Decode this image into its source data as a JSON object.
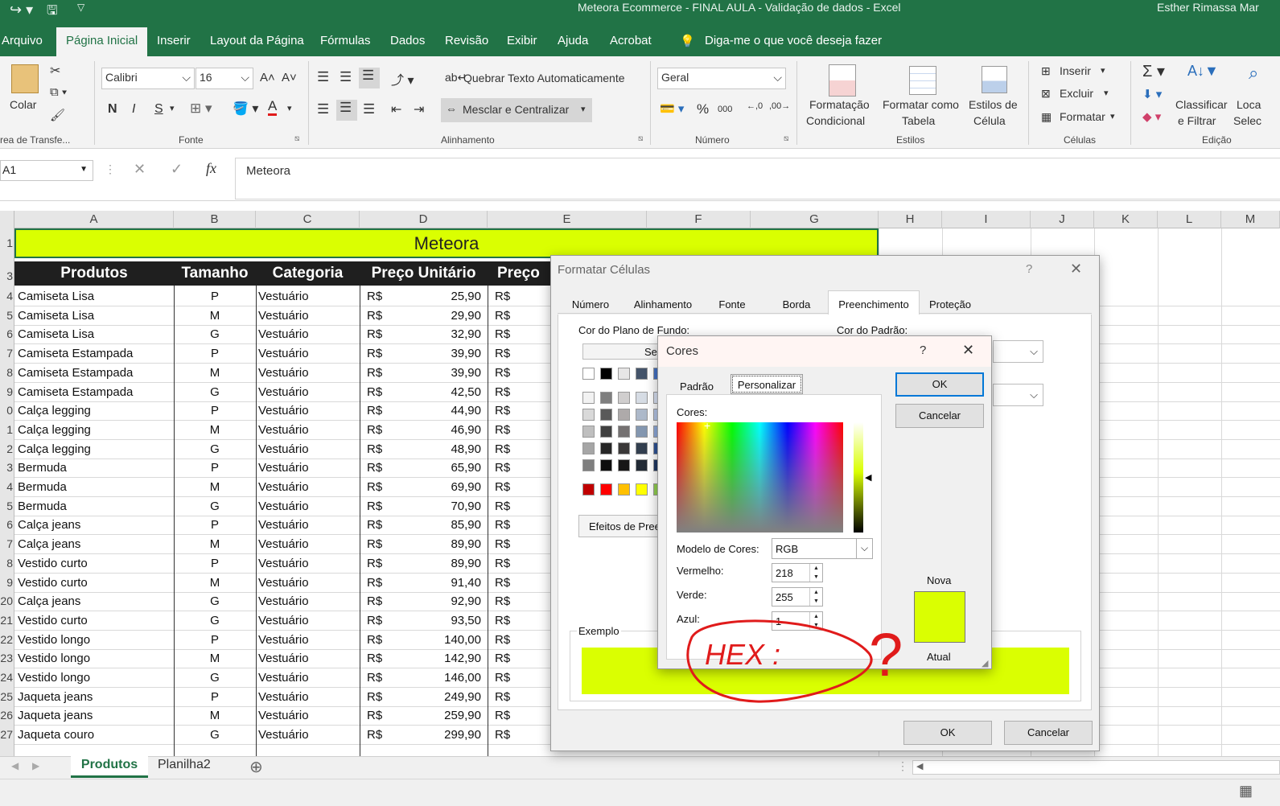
{
  "titlebar": {
    "title": "Meteora Ecommerce - FINAL AULA - Validação de dados  -  Excel",
    "user": "Esther Rimassa Mar"
  },
  "tabs": [
    "Arquivo",
    "Página Inicial",
    "Inserir",
    "Layout da Página",
    "Fórmulas",
    "Dados",
    "Revisão",
    "Exibir",
    "Ajuda",
    "Acrobat"
  ],
  "tell_me": "Diga-me o que você deseja fazer",
  "ribbon": {
    "paste": "Colar",
    "clipboard_group": "rea de Transfe...",
    "font_name": "Calibri",
    "font_size": "16",
    "font_group": "Fonte",
    "bold": "N",
    "italic": "I",
    "underline": "S",
    "wrap_text": "Quebrar Texto Automaticamente",
    "merge_center": "Mesclar e Centralizar",
    "alignment_group": "Alinhamento",
    "number_format": "Geral",
    "number_group": "Número",
    "percent": "%",
    "thousands": "000",
    "cond_format_1": "Formatação",
    "cond_format_2": "Condicional",
    "format_table_1": "Formatar como",
    "format_table_2": "Tabela",
    "cell_styles_1": "Estilos de",
    "cell_styles_2": "Célula",
    "styles_group": "Estilos",
    "insert": "Inserir",
    "delete": "Excluir",
    "format": "Formatar",
    "cells_group": "Células",
    "sort_filter_1": "Classificar",
    "sort_filter_2": "e Filtrar",
    "find_1": "Loca",
    "find_2": "Selec",
    "editing_group": "Edição"
  },
  "formula_bar": {
    "name_box": "A1",
    "fx": "fx",
    "value": "Meteora"
  },
  "columns": [
    "A",
    "B",
    "C",
    "D",
    "E",
    "F",
    "G",
    "H",
    "I",
    "J",
    "K",
    "L",
    "M"
  ],
  "sheet": {
    "title": "Meteora",
    "headers": [
      "Produtos",
      "Tamanho",
      "Categoria",
      "Preço Unitário",
      "Preço"
    ],
    "row_numbers": [
      "1",
      "3",
      "4",
      "5",
      "6",
      "7",
      "8",
      "9",
      "0",
      "1",
      "2",
      "3",
      "4",
      "5",
      "6",
      "7",
      "8",
      "9",
      "20",
      "21",
      "22",
      "23",
      "24",
      "25",
      "26",
      "27"
    ],
    "rows": [
      [
        "Camiseta Lisa",
        "P",
        "Vestuário",
        "R$",
        "25,90",
        "R$"
      ],
      [
        "Camiseta Lisa",
        "M",
        "Vestuário",
        "R$",
        "29,90",
        "R$"
      ],
      [
        "Camiseta Lisa",
        "G",
        "Vestuário",
        "R$",
        "32,90",
        "R$"
      ],
      [
        "Camiseta Estampada",
        "P",
        "Vestuário",
        "R$",
        "39,90",
        "R$"
      ],
      [
        "Camiseta Estampada",
        "M",
        "Vestuário",
        "R$",
        "39,90",
        "R$"
      ],
      [
        "Camiseta Estampada",
        "G",
        "Vestuário",
        "R$",
        "42,50",
        "R$"
      ],
      [
        "Calça legging",
        "P",
        "Vestuário",
        "R$",
        "44,90",
        "R$"
      ],
      [
        "Calça legging",
        "M",
        "Vestuário",
        "R$",
        "46,90",
        "R$"
      ],
      [
        "Calça legging",
        "G",
        "Vestuário",
        "R$",
        "48,90",
        "R$"
      ],
      [
        "Bermuda",
        "P",
        "Vestuário",
        "R$",
        "65,90",
        "R$"
      ],
      [
        "Bermuda",
        "M",
        "Vestuário",
        "R$",
        "69,90",
        "R$"
      ],
      [
        "Bermuda",
        "G",
        "Vestuário",
        "R$",
        "70,90",
        "R$"
      ],
      [
        "Calça jeans",
        "P",
        "Vestuário",
        "R$",
        "85,90",
        "R$"
      ],
      [
        "Calça jeans",
        "M",
        "Vestuário",
        "R$",
        "89,90",
        "R$"
      ],
      [
        "Vestido curto",
        "P",
        "Vestuário",
        "R$",
        "89,90",
        "R$"
      ],
      [
        "Vestido curto",
        "M",
        "Vestuário",
        "R$",
        "91,40",
        "R$"
      ],
      [
        "Calça jeans",
        "G",
        "Vestuário",
        "R$",
        "92,90",
        "R$"
      ],
      [
        "Vestido curto",
        "G",
        "Vestuário",
        "R$",
        "93,50",
        "R$"
      ],
      [
        "Vestido longo",
        "P",
        "Vestuário",
        "R$",
        "140,00",
        "R$"
      ],
      [
        "Vestido longo",
        "M",
        "Vestuário",
        "R$",
        "142,90",
        "R$"
      ],
      [
        "Vestido longo",
        "G",
        "Vestuário",
        "R$",
        "146,00",
        "R$"
      ],
      [
        "Jaqueta jeans",
        "P",
        "Vestuário",
        "R$",
        "249,90",
        "R$"
      ],
      [
        "Jaqueta jeans",
        "M",
        "Vestuário",
        "R$",
        "259,90",
        "R$"
      ],
      [
        "Jaqueta couro",
        "G",
        "Vestuário",
        "R$",
        "299,90",
        "R$"
      ]
    ]
  },
  "sheet_tabs": [
    "Produtos",
    "Planilha2"
  ],
  "format_dialog": {
    "title": "Formatar Células",
    "help": "?",
    "tabs": [
      "Número",
      "Alinhamento",
      "Fonte",
      "Borda",
      "Preenchimento",
      "Proteção"
    ],
    "bg_color_label": "Cor do Plano de Fundo:",
    "pattern_color_label": "Cor do Padrão:",
    "no_color": "Ser",
    "effects": "Efeitos de Pree",
    "sample_label": "Exemplo",
    "ok": "OK",
    "cancel": "Cancelar"
  },
  "colors_dialog": {
    "title": "Cores",
    "help": "?",
    "tab_standard": "Padrão",
    "tab_custom": "Personalizar",
    "colors_label": "Cores:",
    "model_label": "Modelo de Cores:",
    "model_value": "RGB",
    "red_label": "Vermelho:",
    "red_value": "218",
    "green_label": "Verde:",
    "green_value": "255",
    "blue_label": "Azul:",
    "blue_value": "1",
    "new_label": "Nova",
    "current_label": "Atual",
    "ok": "OK",
    "cancel": "Cancelar"
  },
  "annotation": {
    "text": "HEX :",
    "mark": "?"
  },
  "colors": {
    "excel_green": "#217346",
    "title_fill": "#daff01",
    "header_fill": "#1f1f1f",
    "annotation_red": "#e01b1b"
  }
}
